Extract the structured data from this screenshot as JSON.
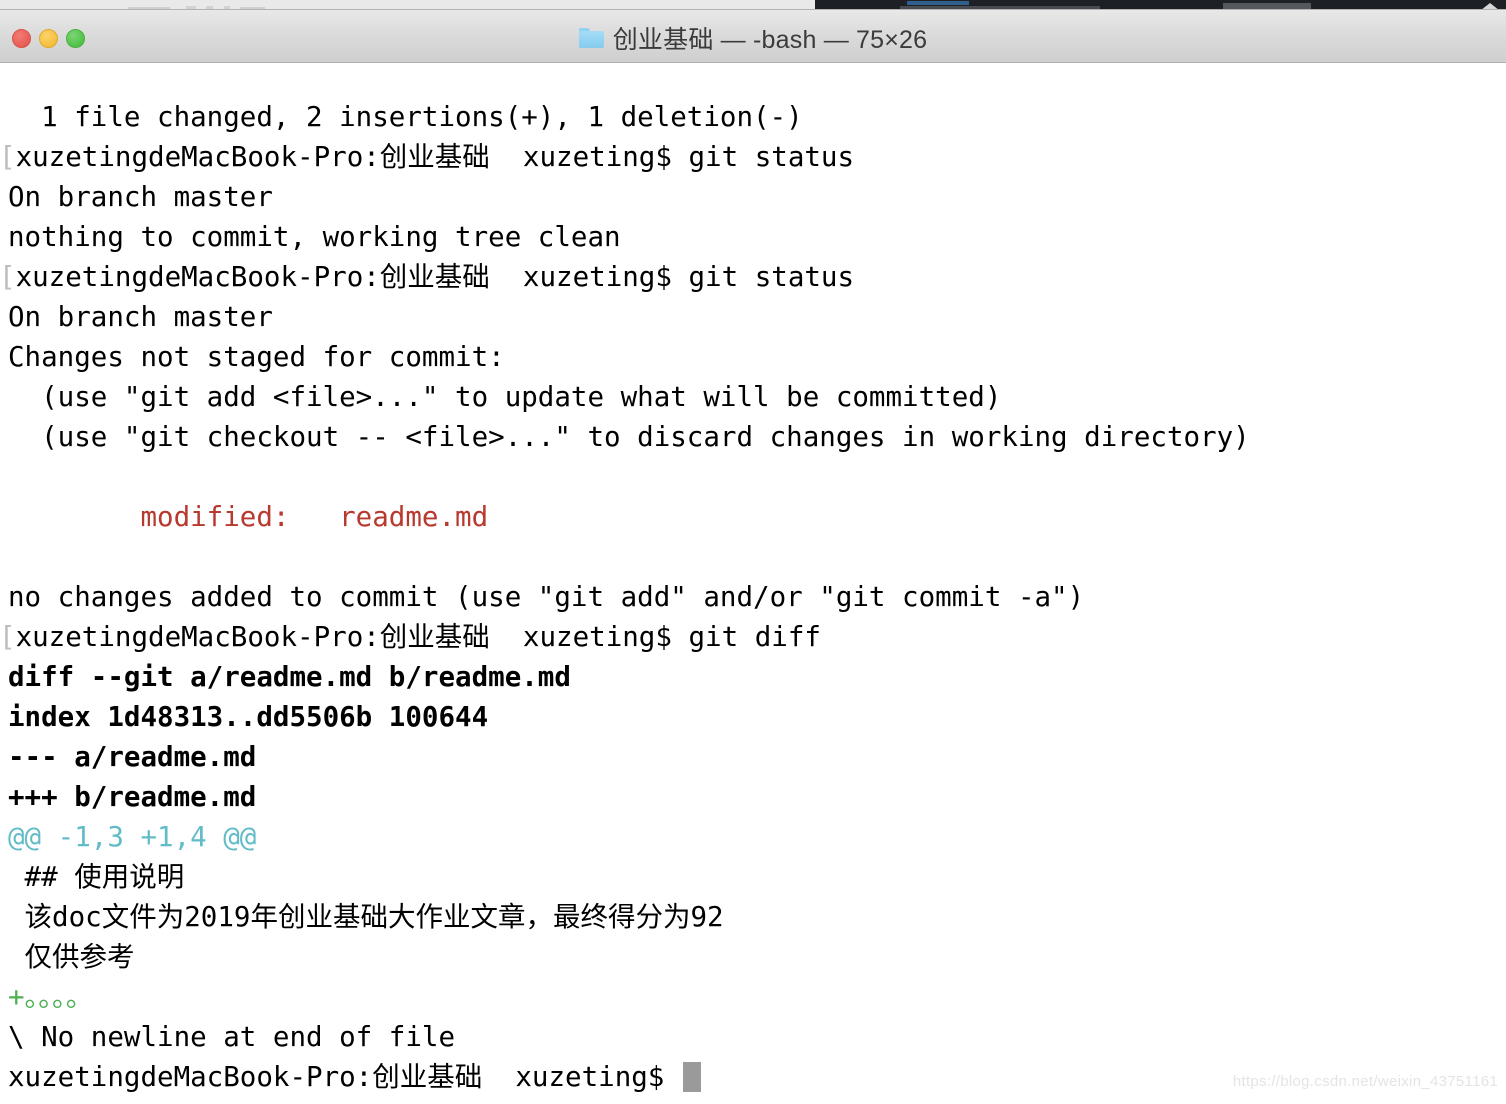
{
  "window": {
    "title": "创业基础 — -bash — 75×26",
    "folder_icon": "folder-icon",
    "traffic_lights": {
      "close_label": "close",
      "minimize_label": "minimize",
      "zoom_label": "zoom",
      "close_color": "#e8605a",
      "minimize_color": "#f6c144",
      "zoom_color": "#55c44d"
    }
  },
  "colors": {
    "background": "#ffffff",
    "foreground": "#000000",
    "red": "#b8392e",
    "cyan": "#62bcc7",
    "green": "#4caf50",
    "cursor": "#9a9a9a",
    "titlebar": "#d9d9d9"
  },
  "terminal": {
    "prompt": "xuzetingdeMacBook-Pro:创业基础  xuzeting$",
    "lines": [
      {
        "text": "  1 file changed, 2 insertions(+), 1 deletion(-)",
        "style": "plain"
      },
      {
        "text": "[xuzetingdeMacBook-Pro:创业基础  xuzeting$ git status",
        "style": "prompt"
      },
      {
        "text": "On branch master",
        "style": "plain"
      },
      {
        "text": "nothing to commit, working tree clean",
        "style": "plain"
      },
      {
        "text": "[xuzetingdeMacBook-Pro:创业基础  xuzeting$ git status",
        "style": "prompt"
      },
      {
        "text": "On branch master",
        "style": "plain"
      },
      {
        "text": "Changes not staged for commit:",
        "style": "plain"
      },
      {
        "text": "  (use \"git add <file>...\" to update what will be committed)",
        "style": "plain"
      },
      {
        "text": "  (use \"git checkout -- <file>...\" to discard changes in working directory)",
        "style": "plain"
      },
      {
        "text": "",
        "style": "plain"
      },
      {
        "text": "        modified:   readme.md",
        "style": "red"
      },
      {
        "text": "",
        "style": "plain"
      },
      {
        "text": "no changes added to commit (use \"git add\" and/or \"git commit -a\")",
        "style": "plain"
      },
      {
        "text": "[xuzetingdeMacBook-Pro:创业基础  xuzeting$ git diff",
        "style": "prompt"
      },
      {
        "text": "diff --git a/readme.md b/readme.md",
        "style": "bold"
      },
      {
        "text": "index 1d48313..dd5506b 100644",
        "style": "bold"
      },
      {
        "text": "--- a/readme.md",
        "style": "bold"
      },
      {
        "text": "+++ b/readme.md",
        "style": "bold"
      },
      {
        "text": "@@ -1,3 +1,4 @@",
        "style": "cyan"
      },
      {
        "text": " ## 使用说明",
        "style": "plain"
      },
      {
        "text": " 该doc文件为2019年创业基础大作业文章，最终得分为92",
        "style": "plain"
      },
      {
        "text": " 仅供参考",
        "style": "plain"
      },
      {
        "text": "+。。。。",
        "style": "green"
      },
      {
        "text": "\\ No newline at end of file",
        "style": "plain"
      },
      {
        "text": "xuzetingdeMacBook-Pro:创业基础  xuzeting$ ",
        "style": "cursor"
      }
    ]
  },
  "watermark": {
    "text": "https://blog.csdn.net/weixin_43751161"
  }
}
